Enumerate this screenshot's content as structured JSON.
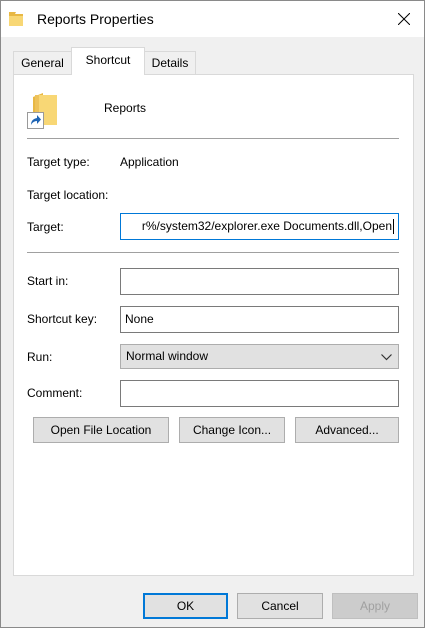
{
  "window": {
    "title": "Reports Properties"
  },
  "tabs": [
    {
      "label": "General"
    },
    {
      "label": "Shortcut"
    },
    {
      "label": "Details"
    }
  ],
  "shortcut": {
    "name": "Reports",
    "target_type_label": "Target type:",
    "target_type_value": "Application",
    "target_location_label": "Target location:",
    "target_label": "Target:",
    "target_value": "r%/system32/explorer.exe Documents.dll,Open",
    "start_in_label": "Start in:",
    "start_in_value": "",
    "shortcut_key_label": "Shortcut key:",
    "shortcut_key_value": "None",
    "run_label": "Run:",
    "run_value": "Normal window",
    "comment_label": "Comment:",
    "comment_value": ""
  },
  "buttons": {
    "open_file_location": "Open File Location",
    "change_icon": "Change Icon...",
    "advanced": "Advanced...",
    "ok": "OK",
    "cancel": "Cancel",
    "apply": "Apply"
  },
  "icons": {
    "title": "folder-icon",
    "large": "folder-shortcut-icon",
    "close": "close-icon",
    "dropdown": "chevron-down-icon"
  },
  "colors": {
    "accent": "#0078d7",
    "folder": "#f8d775",
    "folder_dark": "#e8b844"
  }
}
